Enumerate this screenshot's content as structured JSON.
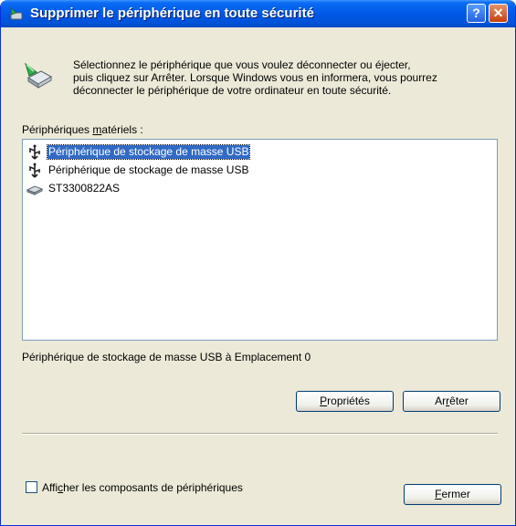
{
  "window": {
    "title": "Supprimer le périphérique en toute sécurité",
    "help_label": "?",
    "close_label": "✕"
  },
  "instructions": {
    "line1": "Sélectionnez le périphérique que vous voulez déconnecter ou éjecter,",
    "line2": "puis cliquez sur Arrêter. Lorsque Windows vous en informera, vous pourrez",
    "line3": "déconnecter le périphérique de votre ordinateur en toute sécurité."
  },
  "devices_label": {
    "pre": "Périphériques ",
    "accel": "m",
    "post": "atériels :"
  },
  "devices": [
    {
      "label": "Périphérique de stockage de masse USB",
      "icon": "usb-icon",
      "selected": true
    },
    {
      "label": "Périphérique de stockage de masse USB",
      "icon": "usb-icon",
      "selected": false
    },
    {
      "label": "ST3300822AS",
      "icon": "hard-drive-icon",
      "selected": false
    }
  ],
  "status_text": "Périphérique de stockage de masse USB à Emplacement 0",
  "buttons": {
    "properties": {
      "accel": "P",
      "rest": "ropriétés"
    },
    "stop": {
      "pre": "Ar",
      "accel": "r",
      "post": "êter"
    },
    "close": {
      "accel": "F",
      "rest": "ermer"
    }
  },
  "show_components": {
    "pre": "Affi",
    "accel": "c",
    "post": "her les composants de périphériques",
    "checked": false
  }
}
